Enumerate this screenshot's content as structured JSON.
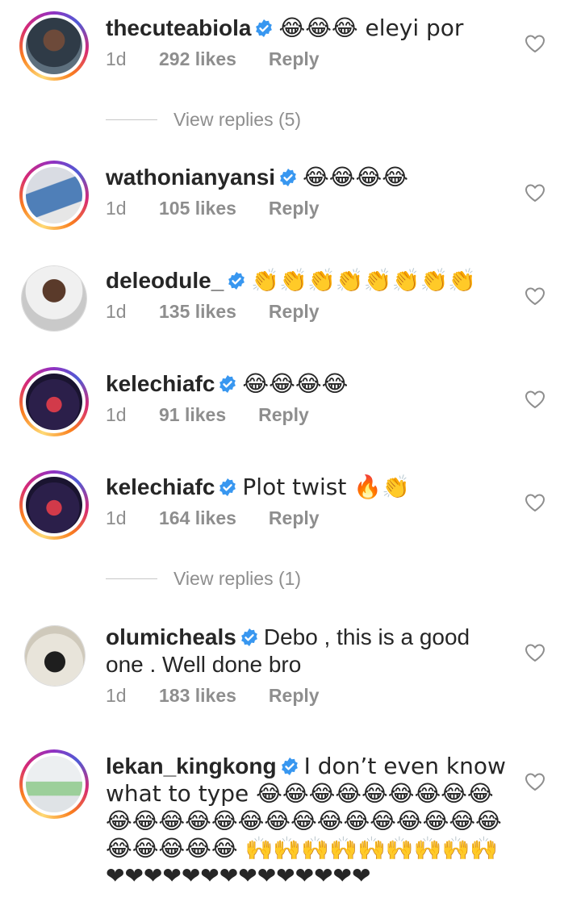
{
  "comments": [
    {
      "username": "thecuteabiola",
      "text": "😂😂😂 eleyi por",
      "time": "1d",
      "likes": "292 likes",
      "reply": "Reply"
    },
    {
      "username": "wathonianyansi",
      "text": "😂😂😂😂",
      "time": "1d",
      "likes": "105 likes",
      "reply": "Reply"
    },
    {
      "username": "deleodule_",
      "text": "👏👏👏👏👏👏👏👏",
      "time": "1d",
      "likes": "135 likes",
      "reply": "Reply"
    },
    {
      "username": "kelechiafc",
      "text": "😂😂😂😂",
      "time": "1d",
      "likes": "91 likes",
      "reply": "Reply"
    },
    {
      "username": "kelechiafc",
      "text": "Plot twist 🔥👏",
      "time": "1d",
      "likes": "164 likes",
      "reply": "Reply"
    },
    {
      "username": "olumicheals",
      "text": "Debo , this is a good one . Well done bro",
      "time": "1d",
      "likes": "183 likes",
      "reply": "Reply"
    },
    {
      "username": "lekan_kingkong",
      "text": "I don’t even know what to type 😂😂😂😂😂😂😂😂😂😂😂😂😂😂😂😂😂😂😂😂😂😂😂😂😂😂😂😂😂 🙌🙌🙌🙌🙌🙌🙌🙌🙌❤❤❤❤❤❤❤❤❤❤❤❤❤❤"
    }
  ],
  "view_replies": [
    {
      "label": "View replies (5)"
    },
    {
      "label": "View replies (1)"
    }
  ],
  "colors": {
    "accent_verified": "#3897f0",
    "muted": "#8e8e8e",
    "text": "#262626"
  },
  "icons": {
    "verified": "verified-badge-icon",
    "like": "heart-outline-icon"
  }
}
